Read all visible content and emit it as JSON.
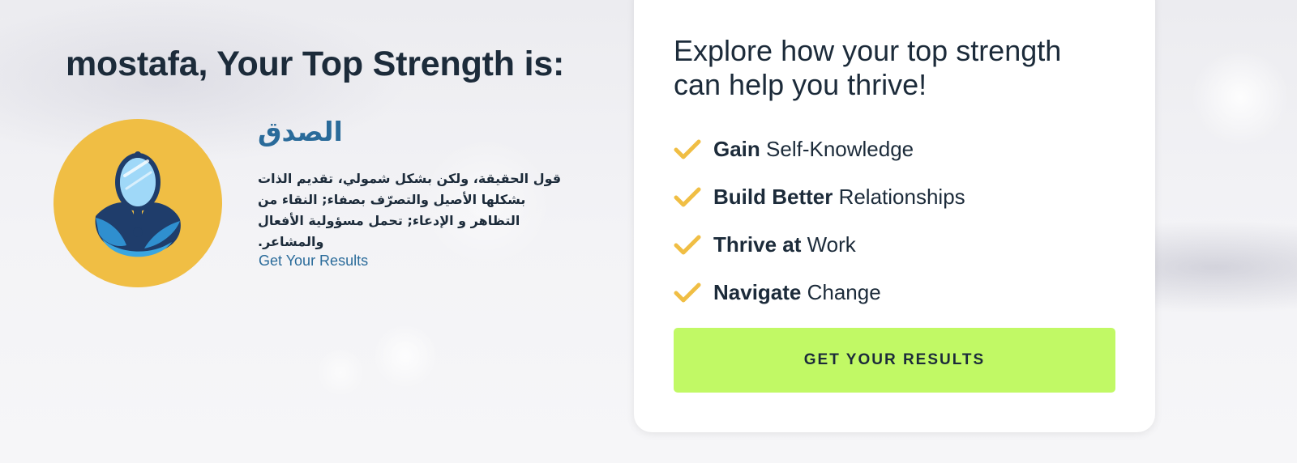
{
  "headline": "mostafa, Your Top Strength is:",
  "strength": {
    "name": "الصدق",
    "description": "قول الحقيقة، ولكن بشكل شمولي، تقديم الذات بشكلها الأصيل والتصرّف بصفاء; النقاء من التظاهر و الإدعاء; تحمل مسؤولية الأفعال والمشاعر.",
    "link_label": "Get Your Results",
    "icon": "hand-mirror-icon"
  },
  "card": {
    "title": "Explore how your top strength can help you thrive!",
    "benefits": [
      {
        "bold": "Gain",
        "rest": " Self-Knowledge",
        "icon": "checkmark-icon"
      },
      {
        "bold": "Build Better",
        "rest": " Relationships",
        "icon": "checkmark-icon"
      },
      {
        "bold": "Thrive at",
        "rest": " Work",
        "icon": "checkmark-icon"
      },
      {
        "bold": "Navigate",
        "rest": " Change",
        "icon": "checkmark-icon"
      }
    ],
    "cta_label": "GET YOUR RESULTS"
  },
  "colors": {
    "text_dark": "#1c2b3a",
    "link_blue": "#2a6b9a",
    "avatar_yellow": "#f0be44",
    "check_yellow": "#f0be44",
    "cta_green": "#c1f965"
  }
}
